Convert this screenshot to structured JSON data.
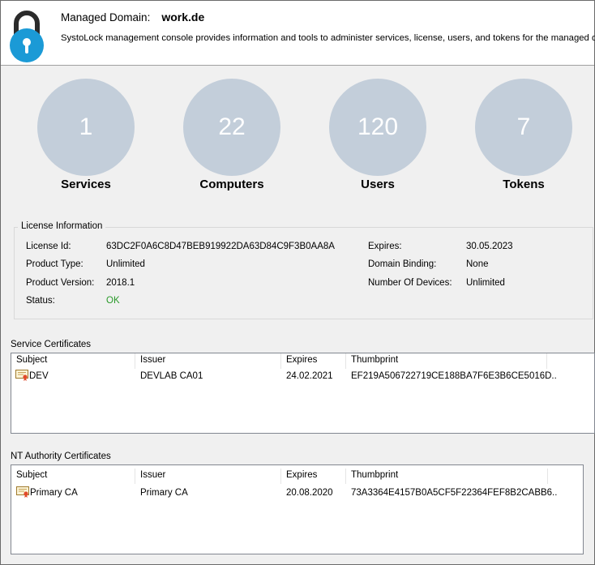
{
  "header": {
    "domain_label": "Managed Domain:",
    "domain_value": "work.de",
    "description": "SystoLock management console provides information and tools to administer services, license, users, and tokens for the managed domain."
  },
  "stats": [
    {
      "value": "1",
      "label": "Services"
    },
    {
      "value": "22",
      "label": "Computers"
    },
    {
      "value": "120",
      "label": "Users"
    },
    {
      "value": "7",
      "label": "Tokens"
    }
  ],
  "license": {
    "title": "License Information",
    "id_label": "License Id:",
    "id_value": "63DC2F0A6C8D47BEB919922DA63D84C9F3B0AA8A",
    "type_label": "Product Type:",
    "type_value": "Unlimited",
    "version_label": "Product Version:",
    "version_value": "2018.1",
    "status_label": "Status:",
    "status_value": "OK",
    "expires_label": "Expires:",
    "expires_value": "30.05.2023",
    "binding_label": "Domain Binding:",
    "binding_value": "None",
    "devices_label": "Number Of Devices:",
    "devices_value": "Unlimited"
  },
  "service_certs": {
    "title": "Service Certificates",
    "columns": [
      "Subject",
      "Issuer",
      "Expires",
      "Thumbprint"
    ],
    "rows": [
      [
        "DEV",
        "DEVLAB CA01",
        "24.02.2021",
        "EF219A506722719CE188BA7F6E3B6CE5016D..."
      ]
    ]
  },
  "nt_certs": {
    "title": "NT Authority Certificates",
    "columns": [
      "Subject",
      "Issuer",
      "Expires",
      "Thumbprint"
    ],
    "rows": [
      [
        "Primary CA",
        "Primary CA",
        "20.08.2020",
        "73A3364E4157B0A5CF5F22364FEF8B2CABB6..."
      ]
    ]
  },
  "colors": {
    "circle": "#c3ceda",
    "lock_body": "#1b9ad6",
    "status_ok": "#2a9a2a"
  }
}
